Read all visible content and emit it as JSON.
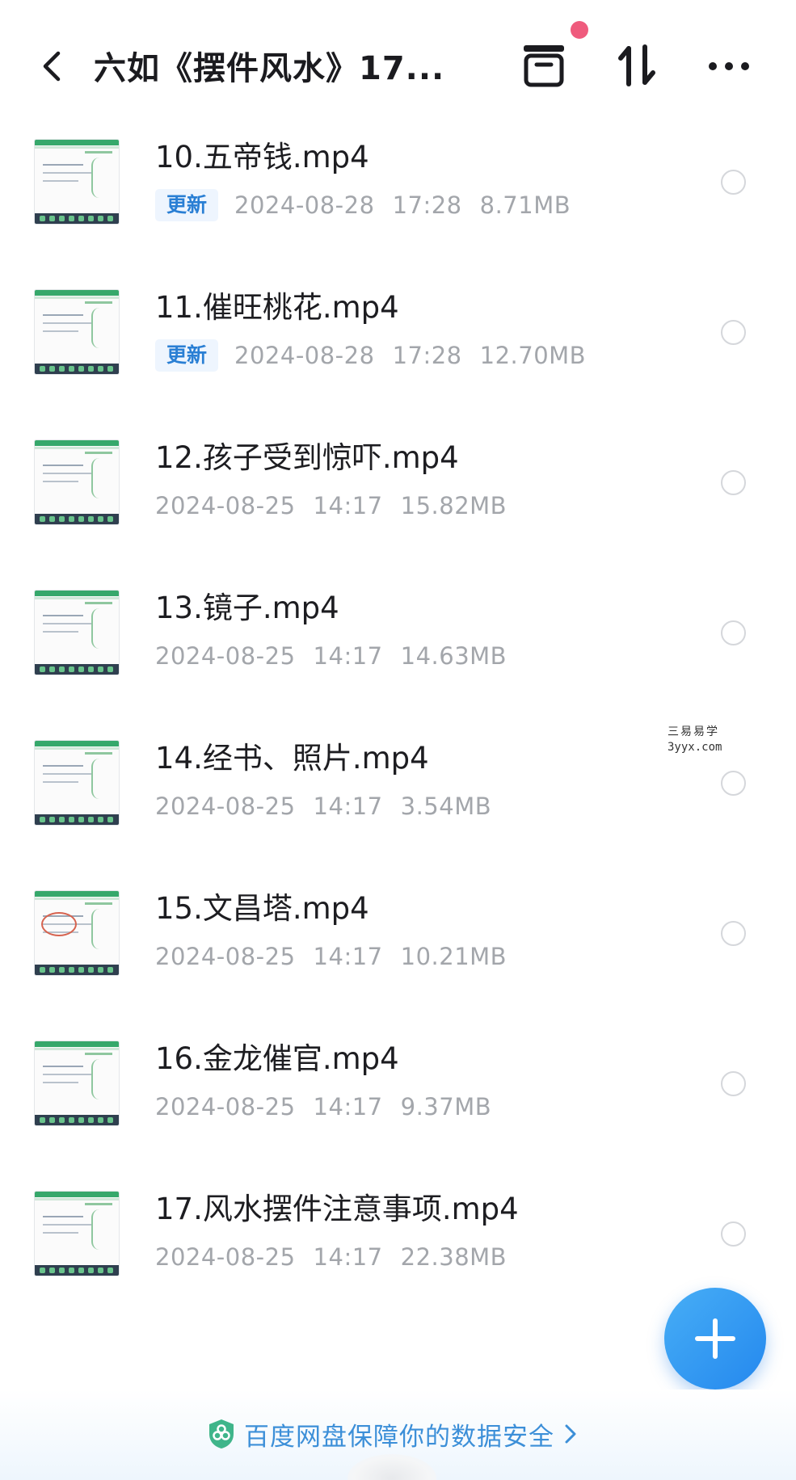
{
  "header": {
    "title": "六如《摆件风水》17...",
    "back_icon": "chevron-left-icon",
    "transfer_icon": "transfer-box-icon",
    "sort_icon": "sort-icon",
    "more_icon": "more-icon",
    "notification_dot_color": "#ef5b7d"
  },
  "files": [
    {
      "name": "10.五帝钱.mp4",
      "badge": "更新",
      "date": "2024-08-28",
      "time": "17:28",
      "size": "8.71MB"
    },
    {
      "name": "11.催旺桃花.mp4",
      "badge": "更新",
      "date": "2024-08-28",
      "time": "17:28",
      "size": "12.70MB"
    },
    {
      "name": "12.孩子受到惊吓.mp4",
      "badge": "",
      "date": "2024-08-25",
      "time": "14:17",
      "size": "15.82MB"
    },
    {
      "name": "13.镜子.mp4",
      "badge": "",
      "date": "2024-08-25",
      "time": "14:17",
      "size": "14.63MB"
    },
    {
      "name": "14.经书、照片.mp4",
      "badge": "",
      "date": "2024-08-25",
      "time": "14:17",
      "size": "3.54MB"
    },
    {
      "name": "15.文昌塔.mp4",
      "badge": "",
      "date": "2024-08-25",
      "time": "14:17",
      "size": "10.21MB"
    },
    {
      "name": "16.金龙催官.mp4",
      "badge": "",
      "date": "2024-08-25",
      "time": "14:17",
      "size": "9.37MB"
    },
    {
      "name": "17.风水摆件注意事项.mp4",
      "badge": "",
      "date": "2024-08-25",
      "time": "14:17",
      "size": "22.38MB"
    }
  ],
  "watermark": {
    "line1": "三易易学",
    "line2": "3yyx.com"
  },
  "fab": {
    "icon": "plus-icon"
  },
  "footer": {
    "text": "百度网盘保障你的数据安全",
    "icon": "shield-icon",
    "arrow_icon": "chevron-right-icon"
  },
  "colors": {
    "accent": "#2a7fd4",
    "fab": "#2f8ff0",
    "meta_text": "#a3a6ab"
  }
}
